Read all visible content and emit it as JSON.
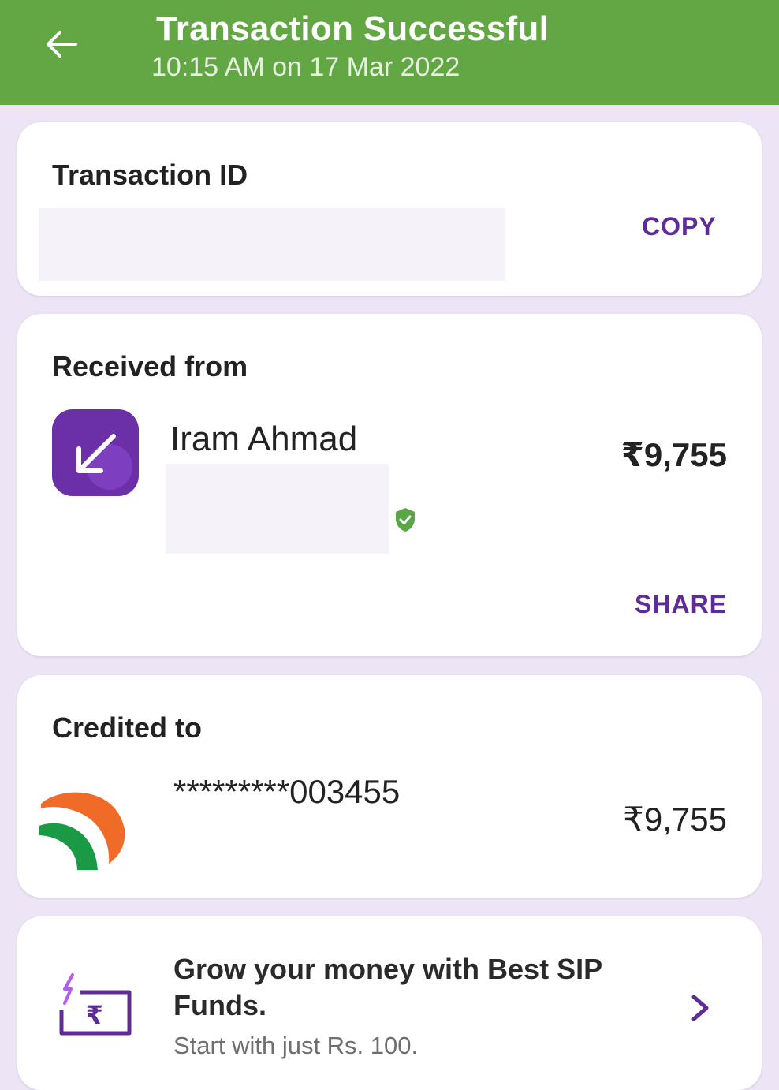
{
  "header": {
    "title": "Transaction Successful",
    "timestamp": "10:15 AM on 17 Mar 2022",
    "background_color": "#62a744",
    "back_icon": "arrow-left-icon"
  },
  "transaction": {
    "title": "Transaction ID",
    "copy_label": "COPY"
  },
  "received": {
    "title": "Received from",
    "icon": "arrow-down-left-icon",
    "name": "Iram Ahmad",
    "verified_icon": "verified-shield-icon",
    "amount": "₹9,755",
    "share_label": "SHARE"
  },
  "credited": {
    "title": "Credited to",
    "bank_logo": "upi-bank-logo",
    "account": "*********003455",
    "amount": "₹9,755"
  },
  "promo": {
    "icon": "rupee-card-icon",
    "title": "Grow your money with Best SIP Funds.",
    "subtitle": "Start with just Rs. 100.",
    "chevron_icon": "chevron-right-icon"
  },
  "colors": {
    "accent_purple": "#5e2b97",
    "success_green": "#62a744",
    "page_background": "#ede5f6"
  }
}
